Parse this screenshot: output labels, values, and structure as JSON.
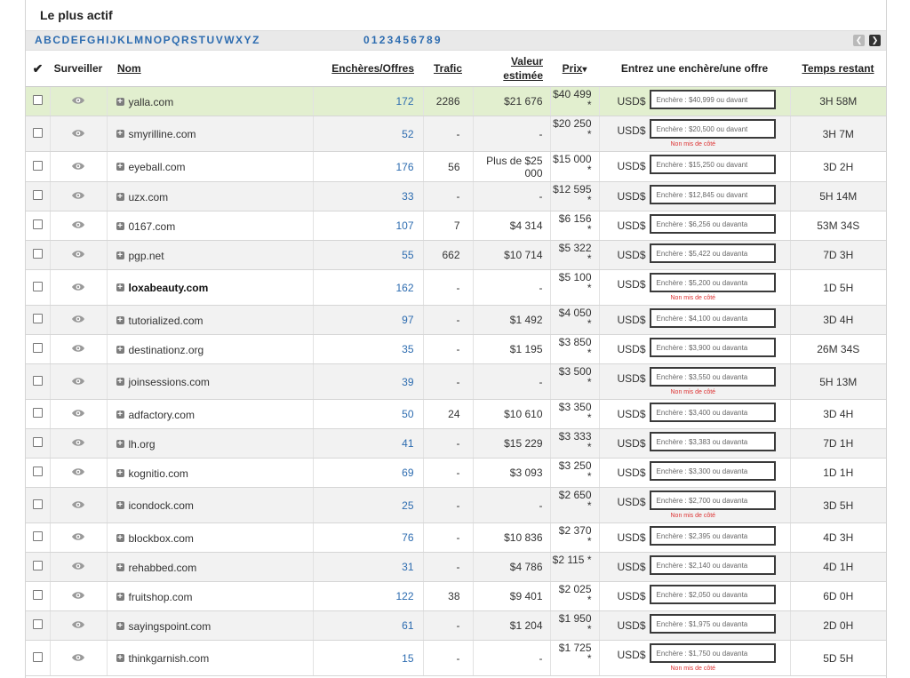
{
  "title": "Le plus actif",
  "filters": {
    "letters": [
      "A",
      "B",
      "C",
      "D",
      "E",
      "F",
      "G",
      "H",
      "I",
      "J",
      "K",
      "L",
      "M",
      "N",
      "O",
      "P",
      "Q",
      "R",
      "S",
      "T",
      "U",
      "V",
      "W",
      "X",
      "Y",
      "Z"
    ],
    "digits": [
      "0",
      "1",
      "2",
      "3",
      "4",
      "5",
      "6",
      "7",
      "8",
      "9"
    ]
  },
  "columns": {
    "check": "✔",
    "watch": "Surveiller",
    "name": "Nom",
    "bids": "Enchères/Offres",
    "traffic": "Trafic",
    "value": "Valeur estimée",
    "price": "Prix",
    "price_sort_icon": "▾",
    "bid": "Entrez une enchère/une offre",
    "time": "Temps restant"
  },
  "currency": "USD$",
  "error_text": "Non mis de côté",
  "colors": {
    "link": "#2d6cb0",
    "highlight_row": "#e2efcf",
    "error": "#d33333"
  },
  "rows": [
    {
      "name": "yalla.com",
      "bids": "172",
      "traffic": "2286",
      "value": "$21 676",
      "price": "$40 499 *",
      "bid_placeholder": "Enchère : $40,999 ou davant",
      "error": "",
      "time": "3H 58M",
      "bold": false,
      "highlight": true
    },
    {
      "name": "smyrilline.com",
      "bids": "52",
      "traffic": "-",
      "value": "-",
      "price": "$20 250 *",
      "bid_placeholder": "Enchère : $20,500 ou davant",
      "error": "Non mis de côté",
      "time": "3H 7M",
      "bold": false,
      "highlight": false
    },
    {
      "name": "eyeball.com",
      "bids": "176",
      "traffic": "56",
      "value": "Plus de $25 000",
      "price": "$15 000 *",
      "bid_placeholder": "Enchère : $15,250 ou davant",
      "error": "",
      "time": "3D 2H",
      "bold": false,
      "highlight": false
    },
    {
      "name": "uzx.com",
      "bids": "33",
      "traffic": "-",
      "value": "-",
      "price": "$12 595 *",
      "bid_placeholder": "Enchère : $12,845 ou davant",
      "error": "",
      "time": "5H 14M",
      "bold": false,
      "highlight": false
    },
    {
      "name": "0167.com",
      "bids": "107",
      "traffic": "7",
      "value": "$4 314",
      "price": "$6 156 *",
      "bid_placeholder": "Enchère : $6,256 ou davanta",
      "error": "",
      "time": "53M 34S",
      "bold": false,
      "highlight": false
    },
    {
      "name": "pgp.net",
      "bids": "55",
      "traffic": "662",
      "value": "$10 714",
      "price": "$5 322 *",
      "bid_placeholder": "Enchère : $5,422 ou davanta",
      "error": "",
      "time": "7D 3H",
      "bold": false,
      "highlight": false
    },
    {
      "name": "loxabeauty.com",
      "bids": "162",
      "traffic": "-",
      "value": "-",
      "price": "$5 100 *",
      "bid_placeholder": "Enchère : $5,200 ou davanta",
      "error": "Non mis de côté",
      "time": "1D 5H",
      "bold": true,
      "highlight": false
    },
    {
      "name": "tutorialized.com",
      "bids": "97",
      "traffic": "-",
      "value": "$1 492",
      "price": "$4 050 *",
      "bid_placeholder": "Enchère : $4,100 ou davanta",
      "error": "",
      "time": "3D 4H",
      "bold": false,
      "highlight": false
    },
    {
      "name": "destinationz.org",
      "bids": "35",
      "traffic": "-",
      "value": "$1 195",
      "price": "$3 850 *",
      "bid_placeholder": "Enchère : $3,900 ou davanta",
      "error": "",
      "time": "26M 34S",
      "bold": false,
      "highlight": false
    },
    {
      "name": "joinsessions.com",
      "bids": "39",
      "traffic": "-",
      "value": "-",
      "price": "$3 500 *",
      "bid_placeholder": "Enchère : $3,550 ou davanta",
      "error": "Non mis de côté",
      "time": "5H 13M",
      "bold": false,
      "highlight": false
    },
    {
      "name": "adfactory.com",
      "bids": "50",
      "traffic": "24",
      "value": "$10 610",
      "price": "$3 350 *",
      "bid_placeholder": "Enchère : $3,400 ou davanta",
      "error": "",
      "time": "3D 4H",
      "bold": false,
      "highlight": false
    },
    {
      "name": "lh.org",
      "bids": "41",
      "traffic": "-",
      "value": "$15 229",
      "price": "$3 333 *",
      "bid_placeholder": "Enchère : $3,383 ou davanta",
      "error": "",
      "time": "7D 1H",
      "bold": false,
      "highlight": false
    },
    {
      "name": "kognitio.com",
      "bids": "69",
      "traffic": "-",
      "value": "$3 093",
      "price": "$3 250 *",
      "bid_placeholder": "Enchère : $3,300 ou davanta",
      "error": "",
      "time": "1D 1H",
      "bold": false,
      "highlight": false
    },
    {
      "name": "icondock.com",
      "bids": "25",
      "traffic": "-",
      "value": "-",
      "price": "$2 650 *",
      "bid_placeholder": "Enchère : $2,700 ou davanta",
      "error": "Non mis de côté",
      "time": "3D 5H",
      "bold": false,
      "highlight": false
    },
    {
      "name": "blockbox.com",
      "bids": "76",
      "traffic": "-",
      "value": "$10 836",
      "price": "$2 370 *",
      "bid_placeholder": "Enchère : $2,395 ou davanta",
      "error": "",
      "time": "4D 3H",
      "bold": false,
      "highlight": false
    },
    {
      "name": "rehabbed.com",
      "bids": "31",
      "traffic": "-",
      "value": "$4 786",
      "price": "$2 115 *",
      "bid_placeholder": "Enchère : $2,140 ou davanta",
      "error": "",
      "time": "4D 1H",
      "bold": false,
      "highlight": false
    },
    {
      "name": "fruitshop.com",
      "bids": "122",
      "traffic": "38",
      "value": "$9 401",
      "price": "$2 025 *",
      "bid_placeholder": "Enchère : $2,050 ou davanta",
      "error": "",
      "time": "6D 0H",
      "bold": false,
      "highlight": false
    },
    {
      "name": "sayingspoint.com",
      "bids": "61",
      "traffic": "-",
      "value": "$1 204",
      "price": "$1 950 *",
      "bid_placeholder": "Enchère : $1,975 ou davanta",
      "error": "",
      "time": "2D 0H",
      "bold": false,
      "highlight": false
    },
    {
      "name": "thinkgarnish.com",
      "bids": "15",
      "traffic": "-",
      "value": "-",
      "price": "$1 725 *",
      "bid_placeholder": "Enchère : $1,750 ou davanta",
      "error": "Non mis de côté",
      "time": "5D 5H",
      "bold": false,
      "highlight": false
    }
  ]
}
